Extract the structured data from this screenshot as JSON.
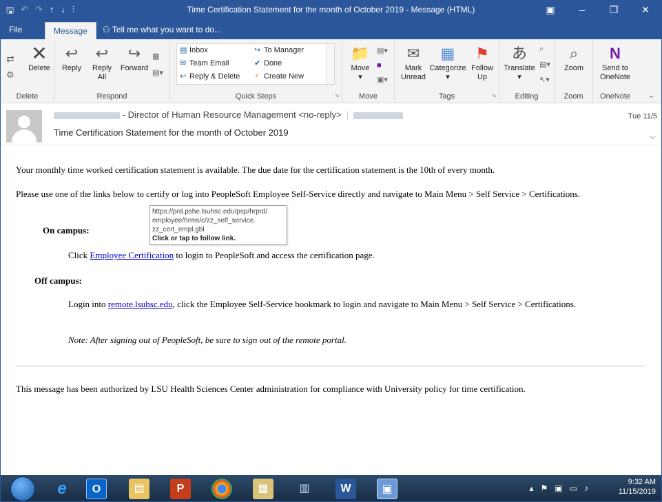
{
  "window": {
    "title": "Time Certification Statement for the month of October 2019 - Message (HTML)"
  },
  "tabs": {
    "file": "File",
    "message": "Message",
    "tell_me": "Tell me what you want to do..."
  },
  "ribbon": {
    "delete_group": {
      "label": "Delete",
      "delete": "Delete"
    },
    "respond_group": {
      "label": "Respond",
      "reply": "Reply",
      "reply_all_1": "Reply",
      "reply_all_2": "All",
      "forward": "Forward"
    },
    "quick_steps": {
      "label": "Quick Steps",
      "items": [
        "Inbox",
        "To Manager",
        "Team Email",
        "Done",
        "Reply & Delete",
        "Create New"
      ]
    },
    "move_group": {
      "label": "Move",
      "move": "Move"
    },
    "tags_group": {
      "label": "Tags",
      "mark_unread_1": "Mark",
      "mark_unread_2": "Unread",
      "categorize": "Categorize",
      "follow_up_1": "Follow",
      "follow_up_2": "Up"
    },
    "editing_group": {
      "label": "Editing",
      "translate": "Translate"
    },
    "zoom_group": {
      "label": "Zoom",
      "zoom": "Zoom"
    },
    "onenote_group": {
      "label": "OneNote",
      "send_1": "Send to",
      "send_2": "OneNote"
    }
  },
  "header": {
    "sender_title": "- Director of Human Resource Management <no-reply>",
    "subject": "Time Certification Statement for the month of October 2019",
    "date": "Tue 11/5"
  },
  "body": {
    "para1": "Your monthly time worked certification statement is available. The due date for the certification statement is the 10th of every month.",
    "para2": "Please use one of the links below to certify or log into PeopleSoft Employee Self-Service directly and navigate to Main Menu > Self Service > Certifications.",
    "on_campus": "On campus:",
    "click_prefix": "Click",
    "link_employee_cert": "Employee Certification",
    "click_suffix": "to login to PeopleSoft and access the certification page.",
    "off_campus": "Off campus:",
    "login_prefix": "Login into",
    "link_remote": "remote.lsuhsc.edu",
    "login_suffix": ", click the Employee Self-Service bookmark to login and navigate to Main Menu > Self Service > Certifications.",
    "note": "Note: After signing out of PeopleSoft, be sure to sign out of the remote portal.",
    "footer": "This message has been authorized by LSU Health Sciences Center administration for compliance with University policy for time certification."
  },
  "tooltip": {
    "line1": "https://prd.pshe.lsuhsc.edu/psp/hrprd/",
    "line2": "employee/hrms/c/zz_self_service.",
    "line3": "zz_cert_empl.gbl",
    "line4": "Click or tap to follow link."
  },
  "taskbar": {
    "time": "9:32 AM",
    "date": "11/15/2019"
  },
  "colors": {
    "titlebar": "#2b579a",
    "link": "#0000cc"
  }
}
